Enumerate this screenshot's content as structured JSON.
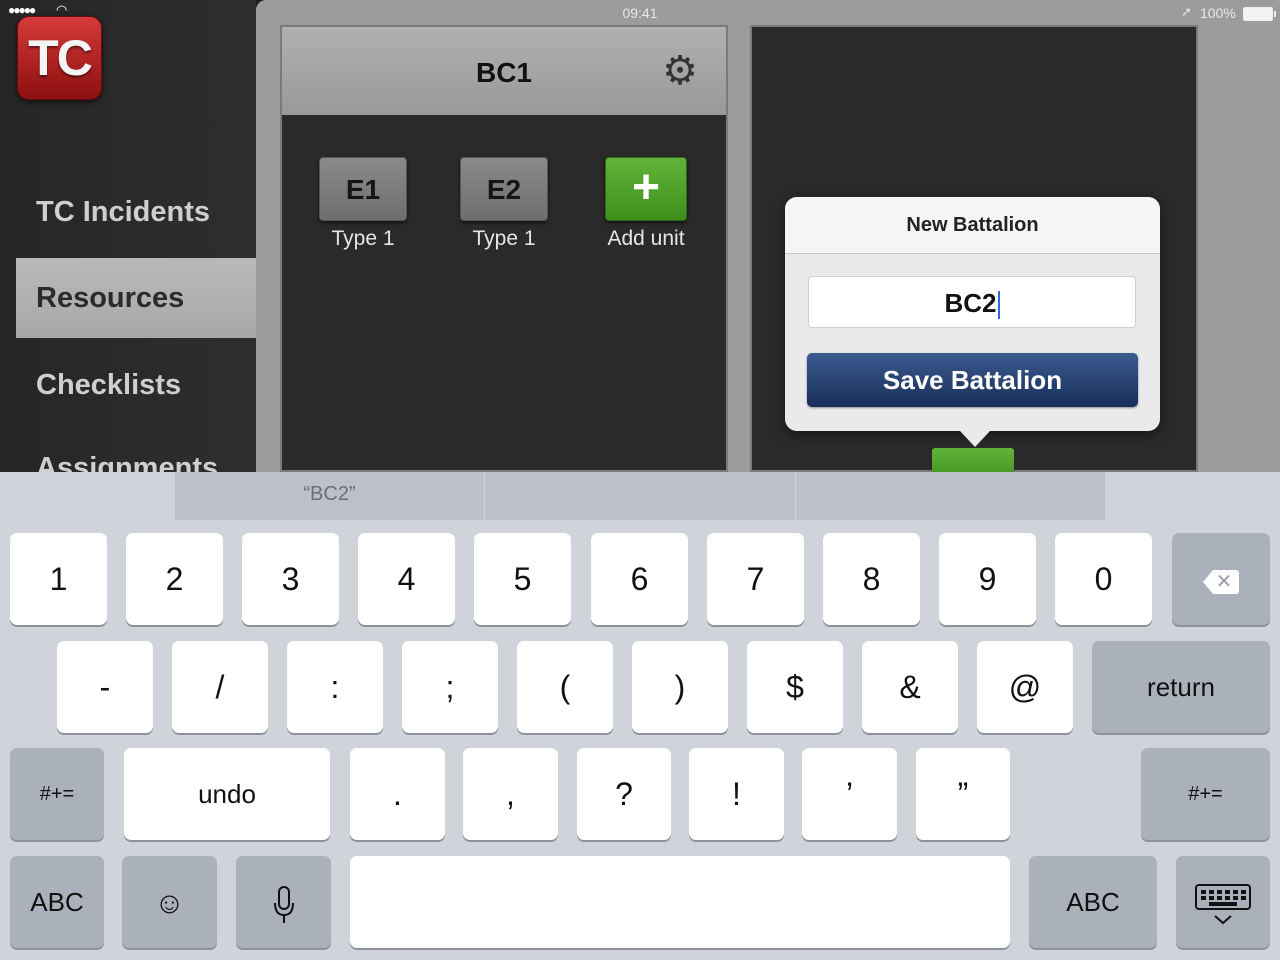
{
  "status_bar": {
    "signal": "●●●●●",
    "time": "09:41",
    "battery": "100%"
  },
  "sidebar": {
    "logo": "TC",
    "items": [
      {
        "label": "TC Incidents"
      },
      {
        "label": "Resources"
      },
      {
        "label": "Checklists"
      },
      {
        "label": "Assignments"
      }
    ]
  },
  "battalion_panel": {
    "title": "BC1",
    "units": [
      {
        "name": "E1",
        "type": "Type 1"
      },
      {
        "name": "E2",
        "type": "Type 1"
      },
      {
        "name": "+",
        "type": "Add unit"
      }
    ]
  },
  "popover": {
    "title": "New Battalion",
    "input_value": "BC2",
    "save_label": "Save Battalion"
  },
  "keyboard": {
    "suggestions": [
      "“BC2”",
      "",
      ""
    ],
    "row1": [
      "1",
      "2",
      "3",
      "4",
      "5",
      "6",
      "7",
      "8",
      "9",
      "0"
    ],
    "row2": [
      "-",
      "/",
      ":",
      ";",
      "(",
      ")",
      "$",
      "&",
      "@"
    ],
    "return_label": "return",
    "row3_left": "#+=",
    "undo_label": "undo",
    "row3": [
      ".",
      ",",
      "?",
      "!",
      "’",
      "”"
    ],
    "row3_right": "#+=",
    "abc_label": "ABC",
    "backspace_icon": "backspace-icon",
    "emoji_icon": "emoji-icon",
    "mic_icon": "microphone-icon",
    "hide_icon": "keyboard-hide-icon"
  },
  "colors": {
    "accent_green": "#4fa12a",
    "save_blue": "#243f6e",
    "logo_red": "#b52222"
  }
}
